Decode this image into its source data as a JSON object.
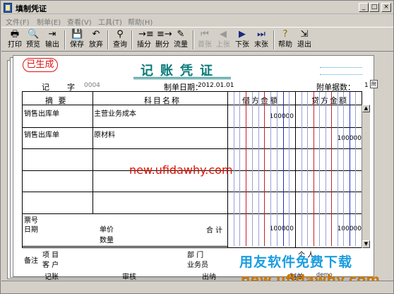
{
  "window": {
    "title": "填制凭证",
    "min": "_",
    "max": "□",
    "close": "×"
  },
  "menu": [
    "文件(F)",
    "制单(E)",
    "查看(V)",
    "工具(T)",
    "帮助(H)"
  ],
  "toolbar": {
    "print": "打印",
    "preview": "预览",
    "export": "输出",
    "save": "保存",
    "discard": "放弃",
    "query": "查询",
    "insert": "插分",
    "delete": "删分",
    "cashflow": "流量",
    "first": "首张",
    "prev": "上张",
    "next": "下张",
    "last": "末张",
    "help": "帮助",
    "exit": "退出"
  },
  "voucher": {
    "stamp": "已生成",
    "title": "记账凭证",
    "word_label": "记",
    "zi_label": "字",
    "number": "0004",
    "date_label": "制单日期：",
    "date": "2012.01.01",
    "attach_label": "附单据数：",
    "attach_count": "1",
    "attach_icon": "附"
  },
  "table": {
    "headers": {
      "summary": "摘 要",
      "account": "科目名称",
      "debit": "借方金额",
      "credit": "贷方金额"
    },
    "rows": [
      {
        "summary": "销售出库单",
        "account": "主营业务成本",
        "debit": "100000",
        "credit": ""
      },
      {
        "summary": "销售出库单",
        "account": "原材料",
        "debit": "",
        "credit": "100000"
      }
    ],
    "footer": {
      "ticket_no": "票号",
      "date": "日期",
      "unit_price": "单价",
      "quantity": "数量",
      "total_label": "合 计",
      "total_debit": "100000",
      "total_credit": "100000"
    }
  },
  "bottom": {
    "remark": "备注",
    "project": "项 目",
    "customer": "客 户",
    "department": "部 门",
    "salesman": "业务员",
    "individual": "个 人"
  },
  "signatures": {
    "bookkeeping": "记账",
    "review": "审核",
    "cashier": "出纳",
    "maker": "制单",
    "maker_name": "demo"
  },
  "watermarks": {
    "url_red": "new.ufidawhy.com",
    "brand": "用友软件免费下载",
    "url_gold": "new.ufidawhy.com"
  },
  "colors": {
    "title_teal": "#0a7a7a",
    "stamp_red": "#dd1111",
    "debit_lines": "#c81e2b",
    "credit_lines": "#1e2bc8"
  }
}
